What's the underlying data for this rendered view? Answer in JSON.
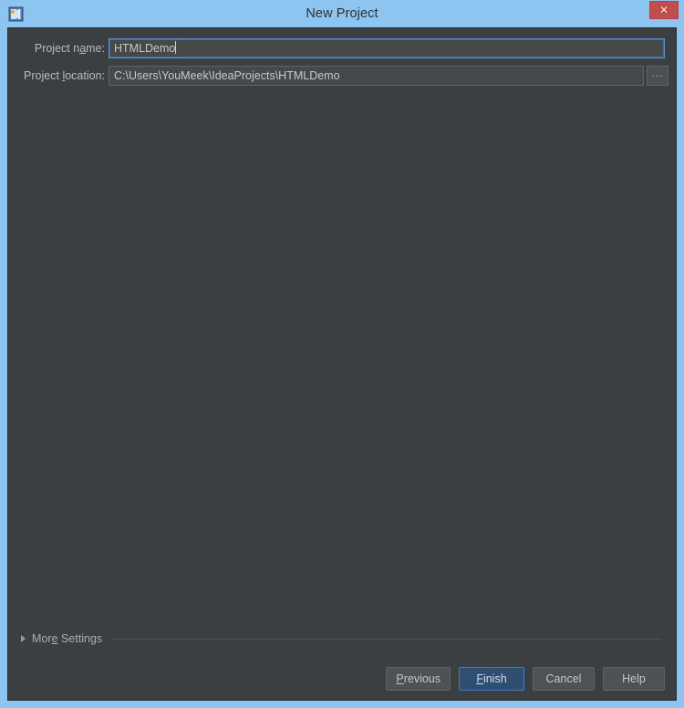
{
  "window": {
    "title": "New Project",
    "app_icon": "intellij-idea-logo-icon",
    "close_label": "✕",
    "frame_color": "#8ec5f0",
    "body_color": "#3c3f41"
  },
  "form": {
    "project_name": {
      "label_before": "Project n",
      "label_mnemonic": "a",
      "label_after": "me:",
      "value": "HTMLDemo",
      "placeholder": ""
    },
    "project_location": {
      "label_before": "Project ",
      "label_mnemonic": "l",
      "label_after": "ocation:",
      "value": "C:\\Users\\YouMeek\\IdeaProjects\\HTMLDemo",
      "placeholder": "",
      "browse_label": "..."
    }
  },
  "more_settings": {
    "label_before": "Mor",
    "label_mnemonic": "e",
    "label_after": " Settings",
    "expanded": false,
    "arrow_icon": "triangle-right-icon"
  },
  "buttons": [
    {
      "before": "",
      "mnemonic": "P",
      "after": "revious",
      "name": "previous-button",
      "default": false
    },
    {
      "before": "",
      "mnemonic": "F",
      "after": "inish",
      "name": "finish-button",
      "default": true
    },
    {
      "before": "Cancel",
      "mnemonic": "",
      "after": "",
      "name": "cancel-button",
      "default": false
    },
    {
      "before": "Help",
      "mnemonic": "",
      "after": "",
      "name": "help-button",
      "default": false
    }
  ],
  "colors": {
    "accent_blue": "#8ec5f0",
    "default_button": "#2e4f72",
    "focus_border": "#5a93cc",
    "close_red": "#c14d4d",
    "dark_bg": "#3c3f41",
    "field_bg": "#45494a"
  }
}
